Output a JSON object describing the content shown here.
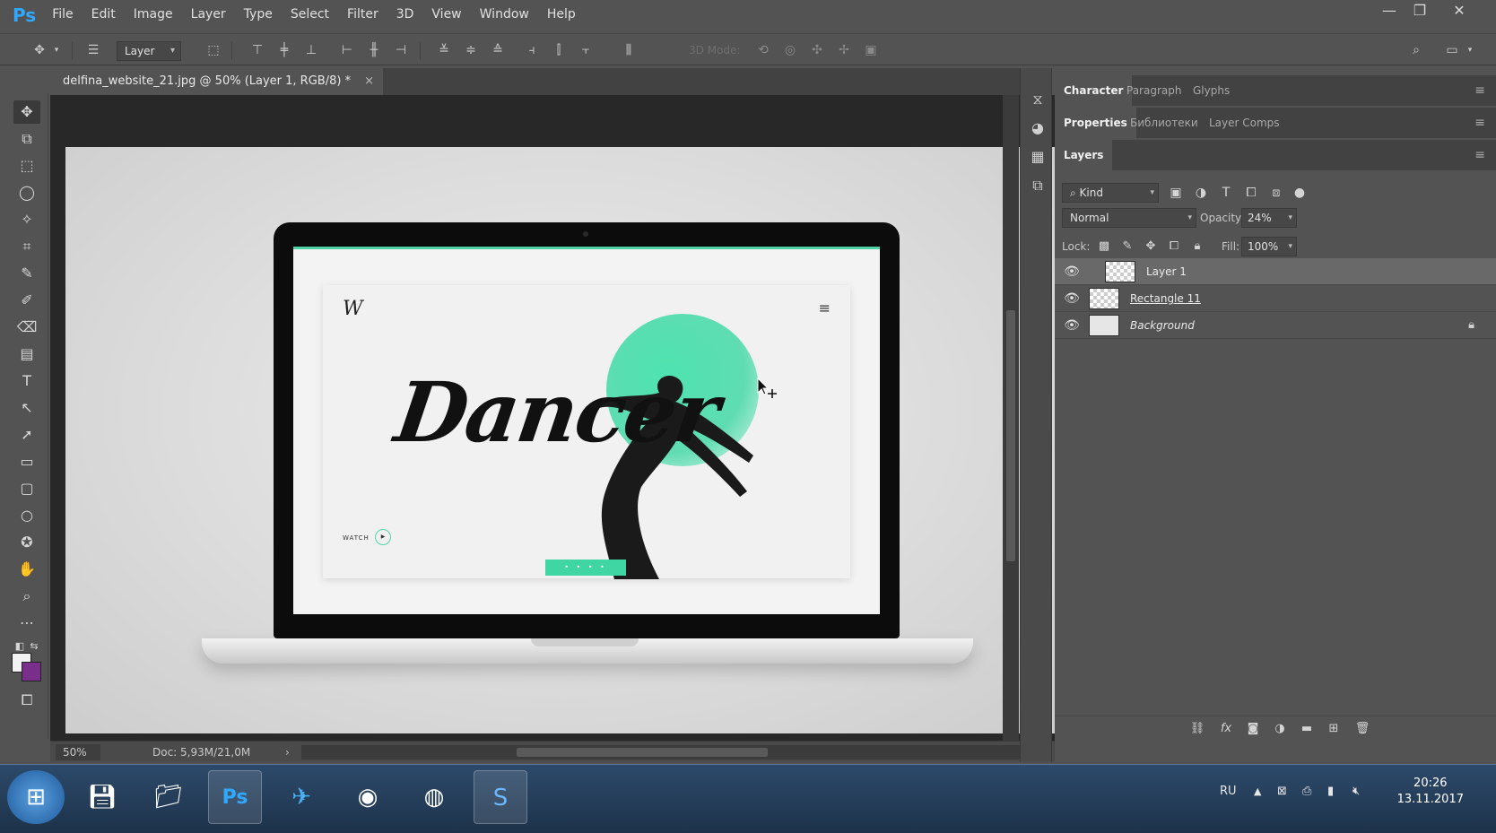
{
  "app": {
    "logo": "Ps"
  },
  "menu": [
    "File",
    "Edit",
    "Image",
    "Layer",
    "Type",
    "Select",
    "Filter",
    "3D",
    "View",
    "Window",
    "Help"
  ],
  "window_controls": {
    "minimize": "—",
    "restore": "❐",
    "close": "✕"
  },
  "options_bar": {
    "auto_select_value": "Layer",
    "mode_3d_label": "3D Mode:"
  },
  "document": {
    "tab_title": "delfina_website_21.jpg @ 50% (Layer 1, RGB/8) *",
    "close_glyph": "×",
    "zoom": "50%",
    "doc_size": "Doc: 5,93M/21,0M"
  },
  "canvas_content": {
    "logo": "W",
    "menu_glyph": "≡",
    "title": "Dancer",
    "watch_label": "WATCH",
    "play_glyph": "▶",
    "cta_label": "• • • •"
  },
  "panels": {
    "tabs_top": [
      "Character",
      "Paragraph",
      "Glyphs"
    ],
    "tabs_mid": [
      "Properties",
      "Библиотеки",
      "Layer Comps"
    ],
    "tabs_layers": [
      "Layers"
    ],
    "kind_label": "Kind",
    "blend_mode": "Normal",
    "opacity_label": "Opacity:",
    "opacity_value": "24%",
    "lock_label": "Lock:",
    "fill_label": "Fill:",
    "fill_value": "100%",
    "layers": [
      {
        "name": "Layer 1",
        "visible": true,
        "selected": true,
        "italic": false
      },
      {
        "name": "Rectangle 11",
        "visible": true,
        "selected": false,
        "italic": false
      },
      {
        "name": "Background",
        "visible": true,
        "selected": false,
        "italic": true,
        "locked": true
      }
    ]
  },
  "taskbar": {
    "language": "RU",
    "time": "20:26",
    "date": "13.11.2017"
  },
  "colors": {
    "accent": "#31a8ff",
    "brand_green": "#3fd6a4",
    "background_swatch": "#7a2e8c"
  }
}
